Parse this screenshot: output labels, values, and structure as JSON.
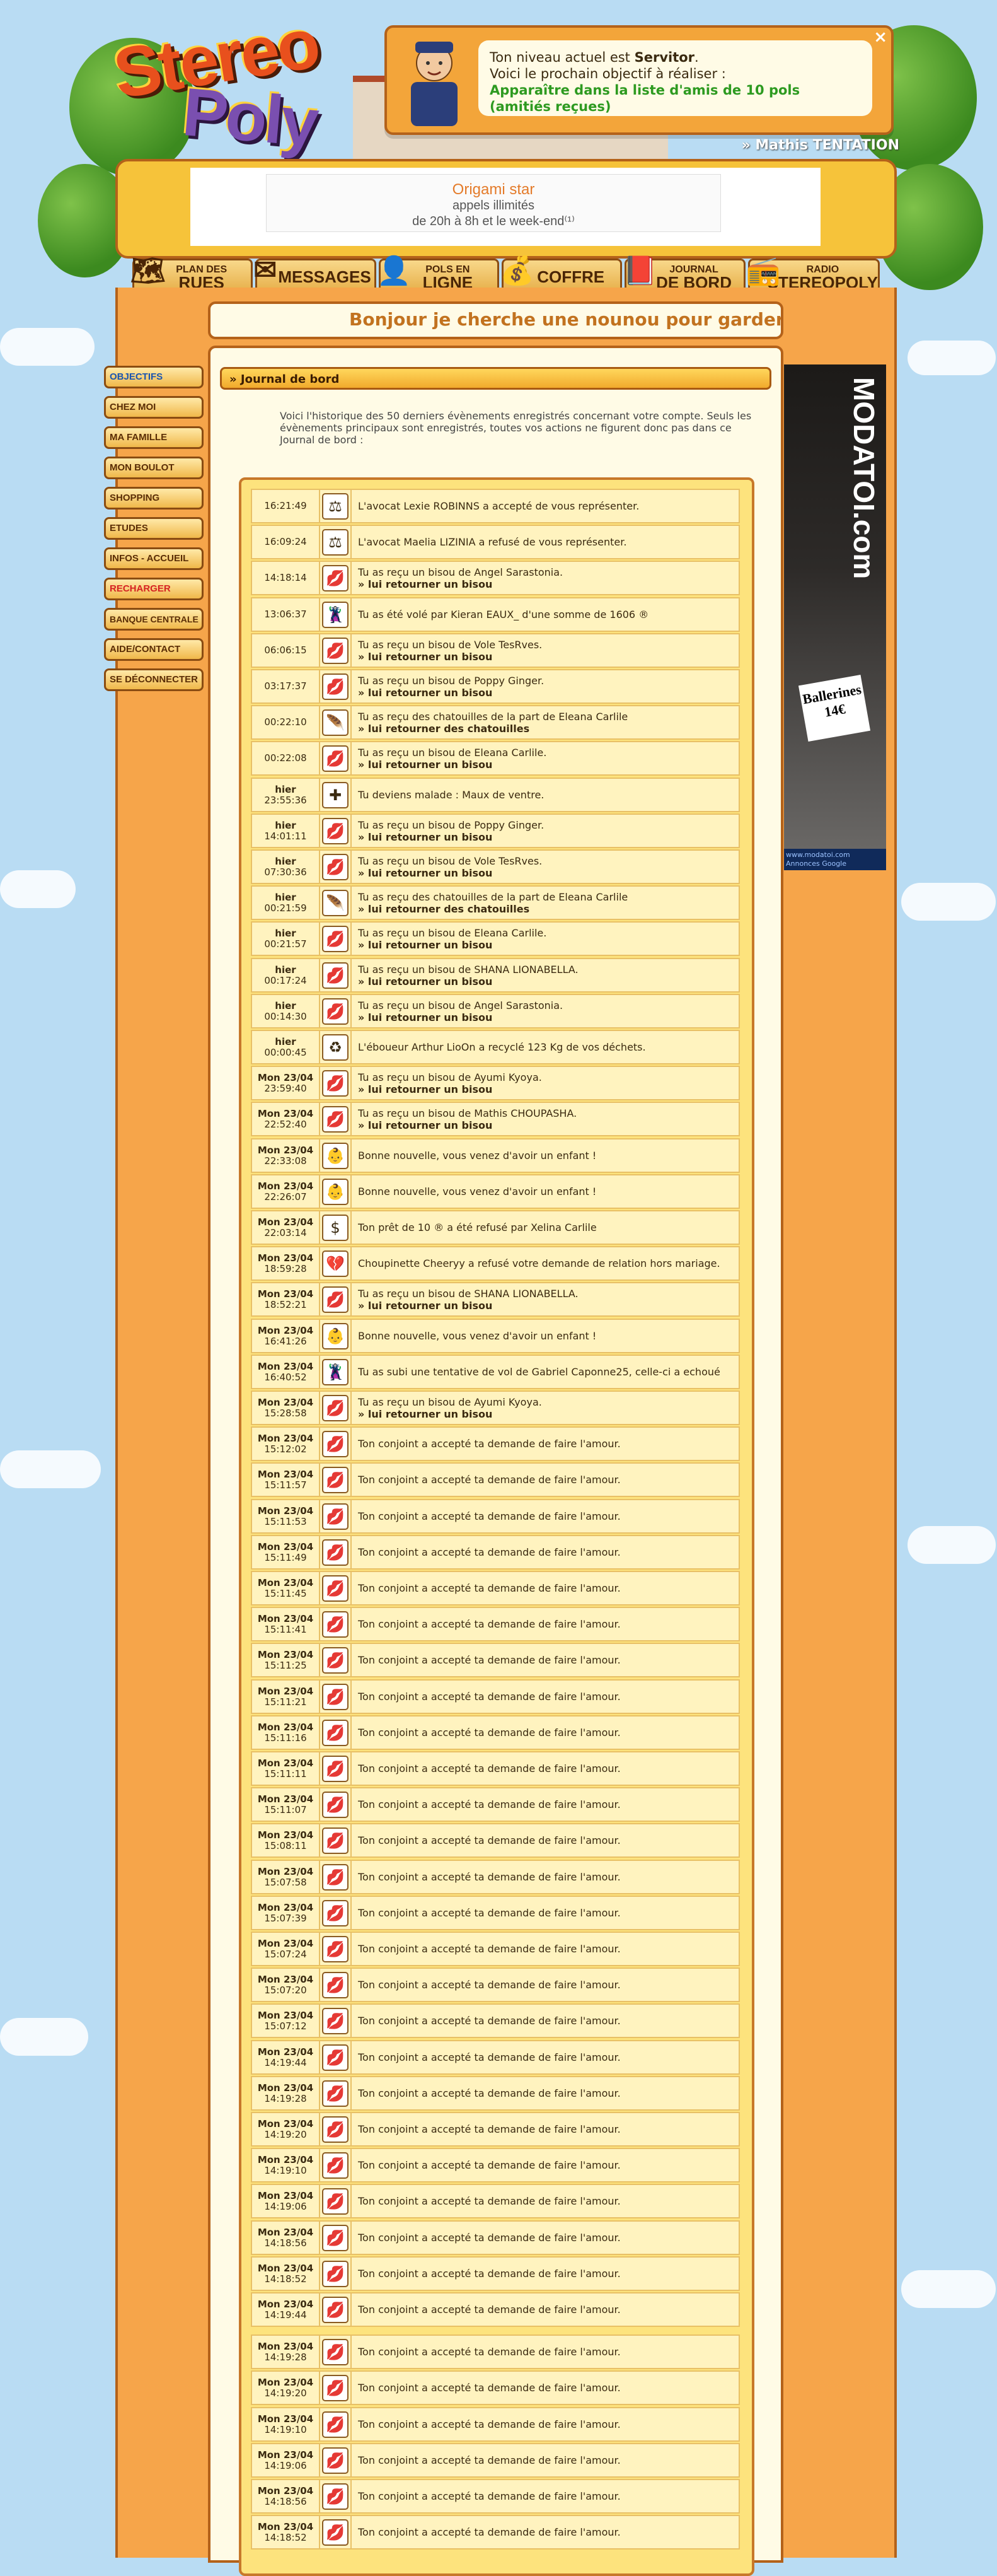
{
  "logo": {
    "line1": "Stereo",
    "line2": "Poly"
  },
  "notification": {
    "line1_prefix": "Ton niveau actuel est ",
    "level": "Servitor",
    "line1_suffix": ".",
    "line2": "Voici le prochain objectif à réaliser :",
    "objective": "Apparaître dans la liste d'amis de 10 pols (amitiés reçues)",
    "close": "×"
  },
  "player": "» Mathis TENTATION",
  "top_ad": {
    "title": "Origami star",
    "line1": "appels illimités",
    "line2": "de 20h à 8h et le week-end⁽¹⁾"
  },
  "nav": [
    {
      "small": "PLAN DES",
      "big": "RUES",
      "icon": "🗺"
    },
    {
      "small": "",
      "big": "MESSAGES",
      "icon": "✉"
    },
    {
      "small": "POLS EN",
      "big": "LIGNE",
      "icon": "👤"
    },
    {
      "small": "",
      "big": "COFFRE",
      "icon": "💰"
    },
    {
      "small": "JOURNAL",
      "big": "DE BORD",
      "icon": "📕"
    },
    {
      "small": "RADIO",
      "big": "STEREOPOLY",
      "icon": "📻"
    }
  ],
  "banner": "Bonjour je cherche une nounou pour garder mes enfants",
  "sidebar": [
    "OBJECTIFS",
    "CHEZ MOI",
    "MA FAMILLE",
    "MON BOULOT",
    "SHOPPING",
    "ETUDES",
    "INFOS - ACCUEIL",
    "RECHARGER",
    "BANQUE CENTRALE",
    "AIDE/CONTACT",
    "SE DÉCONNECTER"
  ],
  "section_title": "» Journal de bord",
  "intro": "Voici l'historique des 50 derniers évènements enregistrés concernant votre compte. Seuls les évènements principaux sont enregistrés, toutes vos actions ne figurent donc pas dans ce Journal de bord :",
  "events": [
    {
      "day": "",
      "time": "16:21:49",
      "icon": "⚖",
      "text": "L'avocat Lexie ROBINNS a accepté de vous représenter.",
      "action": ""
    },
    {
      "day": "",
      "time": "16:09:24",
      "icon": "⚖",
      "text": "L'avocat Maelia LIZINIA a refusé de vous représenter.",
      "action": ""
    },
    {
      "day": "",
      "time": "14:18:14",
      "icon": "💋",
      "text": "Tu as reçu un bisou de Angel Sarastonia.",
      "action": "» lui retourner un bisou"
    },
    {
      "day": "",
      "time": "13:06:37",
      "icon": "🦹",
      "text": "Tu as été volé par Kieran EAUX_ d'une somme de 1606 ®",
      "action": ""
    },
    {
      "day": "",
      "time": "06:06:15",
      "icon": "💋",
      "text": "Tu as reçu un bisou de Vole TesRves.",
      "action": "» lui retourner un bisou"
    },
    {
      "day": "",
      "time": "03:17:37",
      "icon": "💋",
      "text": "Tu as reçu un bisou de Poppy Ginger.",
      "action": "» lui retourner un bisou"
    },
    {
      "day": "",
      "time": "00:22:10",
      "icon": "🪶",
      "text": "Tu as reçu des chatouilles de la part de Eleana Carlile",
      "action": "» lui retourner des chatouilles"
    },
    {
      "day": "",
      "time": "00:22:08",
      "icon": "💋",
      "text": "Tu as reçu un bisou de Eleana Carlile.",
      "action": "» lui retourner un bisou"
    },
    {
      "day": "hier",
      "time": "23:55:36",
      "icon": "✚",
      "text": "Tu deviens malade : Maux de ventre.",
      "action": ""
    },
    {
      "day": "hier",
      "time": "14:01:11",
      "icon": "💋",
      "text": "Tu as reçu un bisou de Poppy Ginger.",
      "action": "» lui retourner un bisou"
    },
    {
      "day": "hier",
      "time": "07:30:36",
      "icon": "💋",
      "text": "Tu as reçu un bisou de Vole TesRves.",
      "action": "» lui retourner un bisou"
    },
    {
      "day": "hier",
      "time": "00:21:59",
      "icon": "🪶",
      "text": "Tu as reçu des chatouilles de la part de Eleana Carlile",
      "action": "» lui retourner des chatouilles"
    },
    {
      "day": "hier",
      "time": "00:21:57",
      "icon": "💋",
      "text": "Tu as reçu un bisou de Eleana Carlile.",
      "action": "» lui retourner un bisou"
    },
    {
      "day": "hier",
      "time": "00:17:24",
      "icon": "💋",
      "text": "Tu as reçu un bisou de SHANA LIONABELLA.",
      "action": "» lui retourner un bisou"
    },
    {
      "day": "hier",
      "time": "00:14:30",
      "icon": "💋",
      "text": "Tu as reçu un bisou de Angel Sarastonia.",
      "action": "» lui retourner un bisou"
    },
    {
      "day": "hier",
      "time": "00:00:45",
      "icon": "♻",
      "text": "L'éboueur Arthur LioOn a recyclé 123 Kg de vos déchets.",
      "action": ""
    },
    {
      "day": "Mon 23/04",
      "time": "23:59:40",
      "icon": "💋",
      "text": "Tu as reçu un bisou de Ayumi Kyoya.",
      "action": "» lui retourner un bisou"
    },
    {
      "day": "Mon 23/04",
      "time": "22:52:40",
      "icon": "💋",
      "text": "Tu as reçu un bisou de Mathis CHOUPASHA.",
      "action": "» lui retourner un bisou"
    },
    {
      "day": "Mon 23/04",
      "time": "22:33:08",
      "icon": "👶",
      "text": "Bonne nouvelle, vous venez d'avoir un enfant !",
      "action": ""
    },
    {
      "day": "Mon 23/04",
      "time": "22:26:07",
      "icon": "👶",
      "text": "Bonne nouvelle, vous venez d'avoir un enfant !",
      "action": ""
    },
    {
      "day": "Mon 23/04",
      "time": "22:03:14",
      "icon": "$",
      "text": "Ton prêt de 10 ® a été refusé par Xelina Carlile",
      "action": ""
    },
    {
      "day": "Mon 23/04",
      "time": "18:59:28",
      "icon": "💔",
      "text": "Choupinette Cheeryy a refusé votre demande de relation hors mariage.",
      "action": ""
    },
    {
      "day": "Mon 23/04",
      "time": "18:52:21",
      "icon": "💋",
      "text": "Tu as reçu un bisou de SHANA LIONABELLA.",
      "action": "» lui retourner un bisou"
    },
    {
      "day": "Mon 23/04",
      "time": "16:41:26",
      "icon": "👶",
      "text": "Bonne nouvelle, vous venez d'avoir un enfant !",
      "action": ""
    },
    {
      "day": "Mon 23/04",
      "time": "16:40:52",
      "icon": "🦹",
      "text": "Tu as subi une tentative de vol de Gabriel Caponne25, celle-ci a echoué",
      "action": ""
    },
    {
      "day": "Mon 23/04",
      "time": "15:28:58",
      "icon": "💋",
      "text": "Tu as reçu un bisou de Ayumi Kyoya.",
      "action": "» lui retourner un bisou"
    },
    {
      "day": "Mon 23/04",
      "time": "15:12:02",
      "icon": "💋",
      "text": "Ton conjoint a accepté ta demande de faire l'amour.",
      "action": ""
    },
    {
      "day": "Mon 23/04",
      "time": "15:11:57",
      "icon": "💋",
      "text": "Ton conjoint a accepté ta demande de faire l'amour.",
      "action": ""
    },
    {
      "day": "Mon 23/04",
      "time": "15:11:53",
      "icon": "💋",
      "text": "Ton conjoint a accepté ta demande de faire l'amour.",
      "action": ""
    },
    {
      "day": "Mon 23/04",
      "time": "15:11:49",
      "icon": "💋",
      "text": "Ton conjoint a accepté ta demande de faire l'amour.",
      "action": ""
    },
    {
      "day": "Mon 23/04",
      "time": "15:11:45",
      "icon": "💋",
      "text": "Ton conjoint a accepté ta demande de faire l'amour.",
      "action": ""
    },
    {
      "day": "Mon 23/04",
      "time": "15:11:41",
      "icon": "💋",
      "text": "Ton conjoint a accepté ta demande de faire l'amour.",
      "action": ""
    },
    {
      "day": "Mon 23/04",
      "time": "15:11:25",
      "icon": "💋",
      "text": "Ton conjoint a accepté ta demande de faire l'amour.",
      "action": ""
    },
    {
      "day": "Mon 23/04",
      "time": "15:11:21",
      "icon": "💋",
      "text": "Ton conjoint a accepté ta demande de faire l'amour.",
      "action": ""
    },
    {
      "day": "Mon 23/04",
      "time": "15:11:16",
      "icon": "💋",
      "text": "Ton conjoint a accepté ta demande de faire l'amour.",
      "action": ""
    },
    {
      "day": "Mon 23/04",
      "time": "15:11:11",
      "icon": "💋",
      "text": "Ton conjoint a accepté ta demande de faire l'amour.",
      "action": ""
    },
    {
      "day": "Mon 23/04",
      "time": "15:11:07",
      "icon": "💋",
      "text": "Ton conjoint a accepté ta demande de faire l'amour.",
      "action": ""
    },
    {
      "day": "Mon 23/04",
      "time": "15:08:11",
      "icon": "💋",
      "text": "Ton conjoint a accepté ta demande de faire l'amour.",
      "action": ""
    },
    {
      "day": "Mon 23/04",
      "time": "15:07:58",
      "icon": "💋",
      "text": "Ton conjoint a accepté ta demande de faire l'amour.",
      "action": ""
    },
    {
      "day": "Mon 23/04",
      "time": "15:07:39",
      "icon": "💋",
      "text": "Ton conjoint a accepté ta demande de faire l'amour.",
      "action": ""
    },
    {
      "day": "Mon 23/04",
      "time": "15:07:24",
      "icon": "💋",
      "text": "Ton conjoint a accepté ta demande de faire l'amour.",
      "action": ""
    },
    {
      "day": "Mon 23/04",
      "time": "15:07:20",
      "icon": "💋",
      "text": "Ton conjoint a accepté ta demande de faire l'amour.",
      "action": ""
    },
    {
      "day": "Mon 23/04",
      "time": "15:07:12",
      "icon": "💋",
      "text": "Ton conjoint a accepté ta demande de faire l'amour.",
      "action": ""
    },
    {
      "day": "Mon 23/04",
      "time": "14:19:44",
      "icon": "💋",
      "text": "Ton conjoint a accepté ta demande de faire l'amour.",
      "action": ""
    },
    {
      "day": "Mon 23/04",
      "time": "14:19:28",
      "icon": "💋",
      "text": "Ton conjoint a accepté ta demande de faire l'amour.",
      "action": ""
    },
    {
      "day": "Mon 23/04",
      "time": "14:19:20",
      "icon": "💋",
      "text": "Ton conjoint a accepté ta demande de faire l'amour.",
      "action": ""
    },
    {
      "day": "Mon 23/04",
      "time": "14:19:10",
      "icon": "💋",
      "text": "Ton conjoint a accepté ta demande de faire l'amour.",
      "action": ""
    },
    {
      "day": "Mon 23/04",
      "time": "14:19:06",
      "icon": "💋",
      "text": "Ton conjoint a accepté ta demande de faire l'amour.",
      "action": ""
    },
    {
      "day": "Mon 23/04",
      "time": "14:18:56",
      "icon": "💋",
      "text": "Ton conjoint a accepté ta demande de faire l'amour.",
      "action": ""
    },
    {
      "day": "Mon 23/04",
      "time": "14:18:52",
      "icon": "💋",
      "text": "Ton conjoint a accepté ta demande de faire l'amour.",
      "action": ""
    },
    {
      "day": "Mon 23/04",
      "time": "14:19:44",
      "icon": "💋",
      "text": "Ton conjoint a accepté ta demande de faire l'amour.",
      "action": ""
    },
    {
      "day": "Mon 23/04",
      "time": "14:19:28",
      "icon": "💋",
      "text": "Ton conjoint a accepté ta demande de faire l'amour.",
      "action": ""
    },
    {
      "day": "Mon 23/04",
      "time": "14:19:20",
      "icon": "💋",
      "text": "Ton conjoint a accepté ta demande de faire l'amour.",
      "action": ""
    },
    {
      "day": "Mon 23/04",
      "time": "14:19:10",
      "icon": "💋",
      "text": "Ton conjoint a accepté ta demande de faire l'amour.",
      "action": ""
    },
    {
      "day": "Mon 23/04",
      "time": "14:19:06",
      "icon": "💋",
      "text": "Ton conjoint a accepté ta demande de faire l'amour.",
      "action": ""
    },
    {
      "day": "Mon 23/04",
      "time": "14:18:56",
      "icon": "💋",
      "text": "Ton conjoint a accepté ta demande de faire l'amour.",
      "action": ""
    },
    {
      "day": "Mon 23/04",
      "time": "14:18:52",
      "icon": "💋",
      "text": "Ton conjoint a accepté ta demande de faire l'amour.",
      "action": ""
    }
  ],
  "right_ad": {
    "brand": "MODATOI.com",
    "promo": "Ballerines 14€",
    "footer": "www.modatoi.com\nAnnonces Google"
  }
}
